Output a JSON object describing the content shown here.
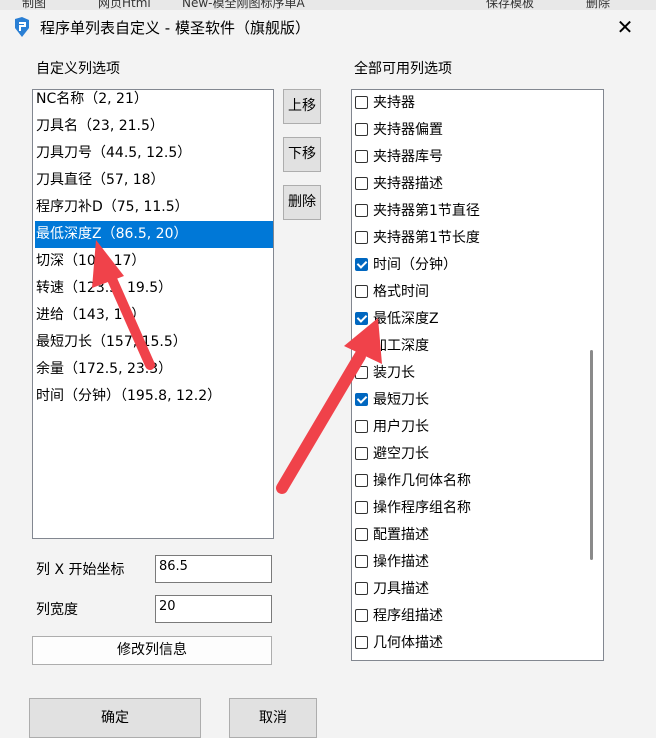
{
  "background_app": {
    "items": [
      "制图",
      "网页Html",
      "New-模全刚图标序单A",
      "保存模板",
      "删除"
    ]
  },
  "window": {
    "title": "程序单列表自定义 - 模圣软件（旗舰版）",
    "close_glyph": "✕"
  },
  "custom_columns": {
    "label": "自定义列选项",
    "items": [
      {
        "label": "NC名称（2, 21）",
        "selected": false
      },
      {
        "label": "刀具名（23, 21.5）",
        "selected": false
      },
      {
        "label": "刀具刀号（44.5, 12.5）",
        "selected": false
      },
      {
        "label": "刀具直径（57, 18）",
        "selected": false
      },
      {
        "label": "程序刀补D（75, 11.5）",
        "selected": false
      },
      {
        "label": "最低深度Z（86.5, 20）",
        "selected": true
      },
      {
        "label": "切深（106, 17）",
        "selected": false
      },
      {
        "label": "转速（123.5, 19.5）",
        "selected": false
      },
      {
        "label": "进给（143, 14）",
        "selected": false
      },
      {
        "label": "最短刀长（157, 15.5）",
        "selected": false
      },
      {
        "label": "余量（172.5, 23.3）",
        "selected": false
      },
      {
        "label": "时间（分钟）（195.8, 12.2）",
        "selected": false
      }
    ]
  },
  "buttons": {
    "move_up": "上移",
    "move_down": "下移",
    "delete": "删除",
    "modify": "修改列信息",
    "ok": "确定",
    "cancel": "取消"
  },
  "fields": {
    "x_label": "列 X 开始坐标",
    "x_value": "86.5",
    "width_label": "列宽度",
    "width_value": "20"
  },
  "available_columns": {
    "label": "全部可用列选项",
    "items": [
      {
        "label": "夹持器",
        "checked": false
      },
      {
        "label": "夹持器偏置",
        "checked": false
      },
      {
        "label": "夹持器库号",
        "checked": false
      },
      {
        "label": "夹持器描述",
        "checked": false
      },
      {
        "label": "夹持器第1节直径",
        "checked": false
      },
      {
        "label": "夹持器第1节长度",
        "checked": false
      },
      {
        "label": "时间（分钟）",
        "checked": true
      },
      {
        "label": "格式时间",
        "checked": false
      },
      {
        "label": "最低深度Z",
        "checked": true
      },
      {
        "label": "加工深度",
        "checked": false
      },
      {
        "label": "装刀长",
        "checked": false
      },
      {
        "label": "最短刀长",
        "checked": true
      },
      {
        "label": "用户刀长",
        "checked": false
      },
      {
        "label": "避空刀长",
        "checked": false
      },
      {
        "label": "操作几何体名称",
        "checked": false
      },
      {
        "label": "操作程序组名称",
        "checked": false
      },
      {
        "label": "配置描述",
        "checked": false
      },
      {
        "label": "操作描述",
        "checked": false
      },
      {
        "label": "刀具描述",
        "checked": false
      },
      {
        "label": "程序组描述",
        "checked": false
      },
      {
        "label": "几何体描述",
        "checked": false
      }
    ]
  },
  "colors": {
    "selection": "#0078d7",
    "checkbox": "#0067c0",
    "arrow": "#f0424a"
  }
}
